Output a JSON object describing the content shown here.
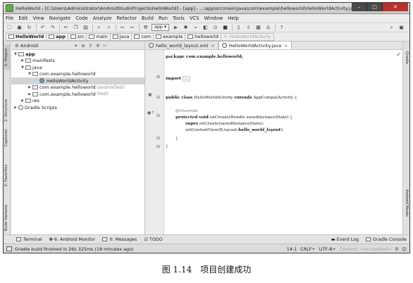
{
  "window": {
    "title": "HelloWorld - [C:\\Users\\Administrator\\AndroidStudioProjects\\HelloWorld] - [app] - ...\\app\\src\\main\\java\\com\\example\\helloworld\\HelloWorldActivity.ja...",
    "min": "–",
    "max": "□",
    "close": "✕"
  },
  "menu": [
    "File",
    "Edit",
    "View",
    "Navigate",
    "Code",
    "Analyze",
    "Refactor",
    "Build",
    "Run",
    "Tools",
    "VCS",
    "Window",
    "Help"
  ],
  "toolbar": {
    "run_config": "app"
  },
  "breadcrumb": [
    "HelloWorld",
    "app",
    "src",
    "main",
    "java",
    "com",
    "example",
    "helloworld",
    "HelloWorldActivity"
  ],
  "project": {
    "view_mode": "Android",
    "tree": [
      {
        "label": "app",
        "bold": true
      },
      {
        "label": "manifests"
      },
      {
        "label": "java"
      },
      {
        "label": "com.example.helloworld"
      },
      {
        "label": "HelloWorldActivity"
      },
      {
        "label": "com.example.helloworld",
        "suffix": "(androidTest)"
      },
      {
        "label": "com.example.helloworld",
        "suffix": "(test)"
      },
      {
        "label": "res"
      },
      {
        "label": "Gradle Scripts"
      }
    ]
  },
  "left_tabs": [
    "1: Project",
    "2: Structure",
    "Captures",
    "2: Favorites",
    "Build Variants"
  ],
  "right_tabs": [
    "Gradle",
    "Android Model"
  ],
  "editor": {
    "tabs": [
      "hello_world_layout.xml",
      "HelloWorldActivity.java"
    ],
    "code": {
      "line1": "package com.example.helloworld;",
      "line2_kw": "import",
      "line2_fold": "...",
      "line3_a": "public class",
      "line3_b": "HelloWorldActivity",
      "line3_c": "extends",
      "line3_d": "AppCompatActivity {",
      "line4": "@Override",
      "line5_a": "protected void",
      "line5_b": "onCreate(Bundle savedInstanceState) {",
      "line6_a": "super",
      "line6_b": ".onCreate(savedInstanceState);",
      "line7_a": "setContentView(R.layout.",
      "line7_b": "hello_world_layout",
      "line7_c": ");",
      "line8": "}",
      "line9": "}"
    }
  },
  "bottom_tools": [
    "Terminal",
    "6: Android Monitor",
    "0: Messages",
    "TODO"
  ],
  "bottom_right_tools": [
    "Event Log",
    "Gradle Console"
  ],
  "status": {
    "message": "Gradle build finished in 26s 325ms (18 minutes ago)",
    "position": "14:1",
    "line_sep": "CRLF÷",
    "encoding": "UTF-8÷",
    "context": "Context: <no context>"
  },
  "caption": "图 1.14　项目创建成功"
}
